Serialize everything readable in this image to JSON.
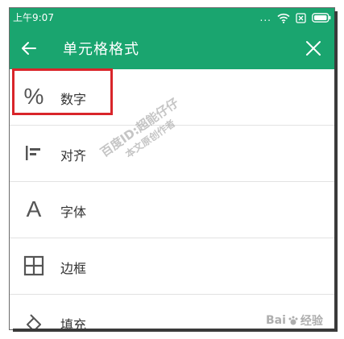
{
  "status_bar": {
    "time": "上午9:07",
    "dots": "...",
    "icons": [
      "signal-dots-icon",
      "wifi-icon",
      "sim-disabled-icon",
      "battery-icon"
    ]
  },
  "app_bar": {
    "title": "单元格格式",
    "back_icon": "arrow-left-icon",
    "close_icon": "close-icon"
  },
  "menu": {
    "items": [
      {
        "label": "数字",
        "icon": "percent-icon",
        "glyph": "%"
      },
      {
        "label": "对齐",
        "icon": "align-left-icon"
      },
      {
        "label": "字体",
        "icon": "font-icon",
        "glyph": "A"
      },
      {
        "label": "边框",
        "icon": "border-grid-icon"
      },
      {
        "label": "填充",
        "icon": "fill-bucket-icon"
      }
    ]
  },
  "watermark": {
    "line1": "百度ID:超能仔仔",
    "line2": "本文原创作者"
  },
  "logo": {
    "text": "Bai",
    "text2": "经验"
  },
  "colors": {
    "accent": "#1aa56f",
    "highlight": "#d9252a"
  }
}
